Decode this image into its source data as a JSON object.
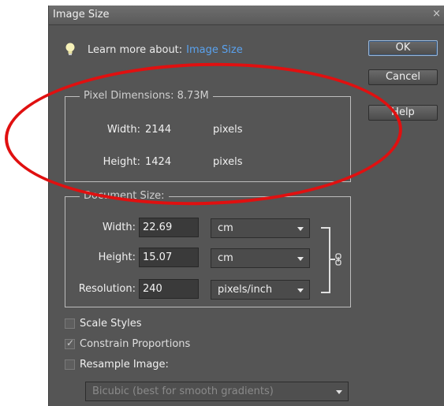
{
  "window": {
    "title": "Image Size",
    "close_glyph": "×"
  },
  "learn_more": {
    "text": "Learn more about:",
    "link": "Image Size",
    "icon": "lightbulb-icon"
  },
  "buttons": {
    "ok": "OK",
    "cancel": "Cancel",
    "help": "Help"
  },
  "pixel_dimensions": {
    "legend": "Pixel Dimensions:  8.73M",
    "width_label": "Width:",
    "width_value": "2144",
    "width_unit": "pixels",
    "height_label": "Height:",
    "height_value": "1424",
    "height_unit": "pixels"
  },
  "document_size": {
    "legend": "Document Size:",
    "width_label": "Width:",
    "width_value": "22.69",
    "width_unit": "cm",
    "height_label": "Height:",
    "height_value": "15.07",
    "height_unit": "cm",
    "resolution_label": "Resolution:",
    "resolution_value": "240",
    "resolution_unit": "pixels/inch",
    "link_icon": "chain-link-icon"
  },
  "options": {
    "scale_styles": {
      "label": "Scale Styles",
      "checked": false
    },
    "constrain_proportions": {
      "label": "Constrain Proportions",
      "checked": true
    },
    "resample_image": {
      "label": "Resample Image:",
      "checked": false
    },
    "resample_method": "Bicubic (best for smooth gradients)"
  },
  "annotation": {
    "color": "#e01010",
    "shape": "ellipse"
  },
  "colors": {
    "dialog_bg": "#555555",
    "link": "#5aa2ee",
    "text": "#f0f0f0"
  }
}
